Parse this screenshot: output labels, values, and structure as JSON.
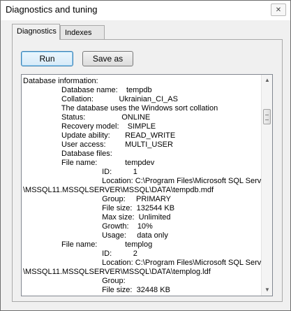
{
  "window": {
    "title": "Diagnostics and tuning"
  },
  "tabs": [
    {
      "label": "Diagnostics",
      "active": true
    },
    {
      "label": "Indexes",
      "active": false
    }
  ],
  "toolbar": {
    "run_label": "Run",
    "save_label": "Save as"
  },
  "output": {
    "lines": [
      "Database information:",
      "                  Database name:    tempdb",
      "                  Collation:            Ukrainian_CI_AS",
      "                  The database uses the Windows sort collation",
      "                  Status:                 ONLINE",
      "                  Recovery model:    SIMPLE",
      "                  Update ability:       READ_WRITE",
      "                  User access:         MULTI_USER",
      "                  Database files:",
      "                  File name:             tempdev",
      "                                     ID:          1",
      "                                     Location: C:\\Program Files\\Microsoft SQL Server",
      "\\MSSQL11.MSSQLSERVER\\MSSQL\\DATA\\tempdb.mdf",
      "                                     Group:     PRIMARY",
      "                                     File size:  132544 KB",
      "                                     Max size:  Unlimited",
      "                                     Growth:    10%",
      "                                     Usage:     data only",
      "                  File name:             templog",
      "                                     ID:          2",
      "                                     Location: C:\\Program Files\\Microsoft SQL Server",
      "\\MSSQL11.MSSQLSERVER\\MSSQL\\DATA\\templog.ldf",
      "                                     Group:",
      "                                     File size:  32448 KB"
    ]
  },
  "icons": {
    "close": "close-icon",
    "scroll_up": "arrow-up-icon",
    "scroll_down": "arrow-down-icon"
  }
}
